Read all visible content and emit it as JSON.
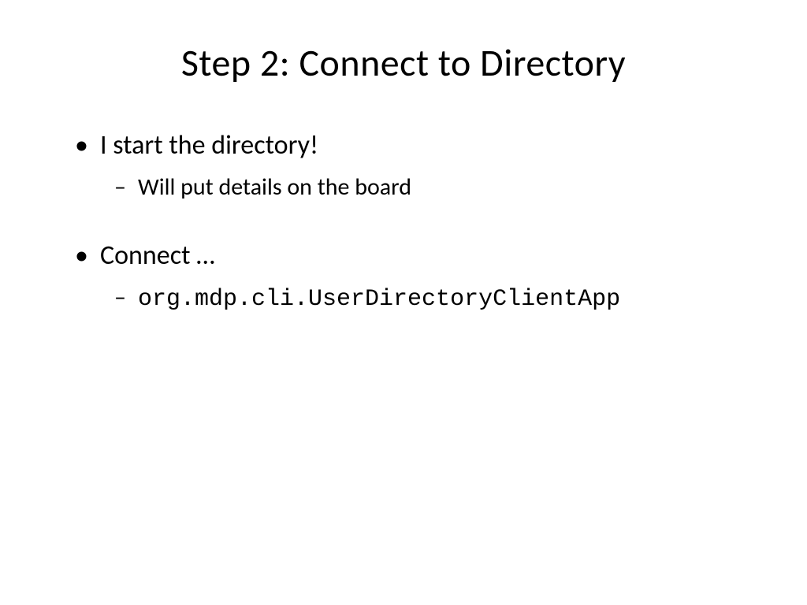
{
  "slide": {
    "title": "Step 2: Connect to Directory",
    "bullets": [
      {
        "text": "I start the directory!",
        "sub": [
          {
            "text": "Will put details on the board",
            "mono": false
          }
        ]
      },
      {
        "text": "Connect …",
        "sub": [
          {
            "text": "org.mdp.cli.UserDirectoryClientApp",
            "mono": true
          }
        ]
      }
    ]
  }
}
